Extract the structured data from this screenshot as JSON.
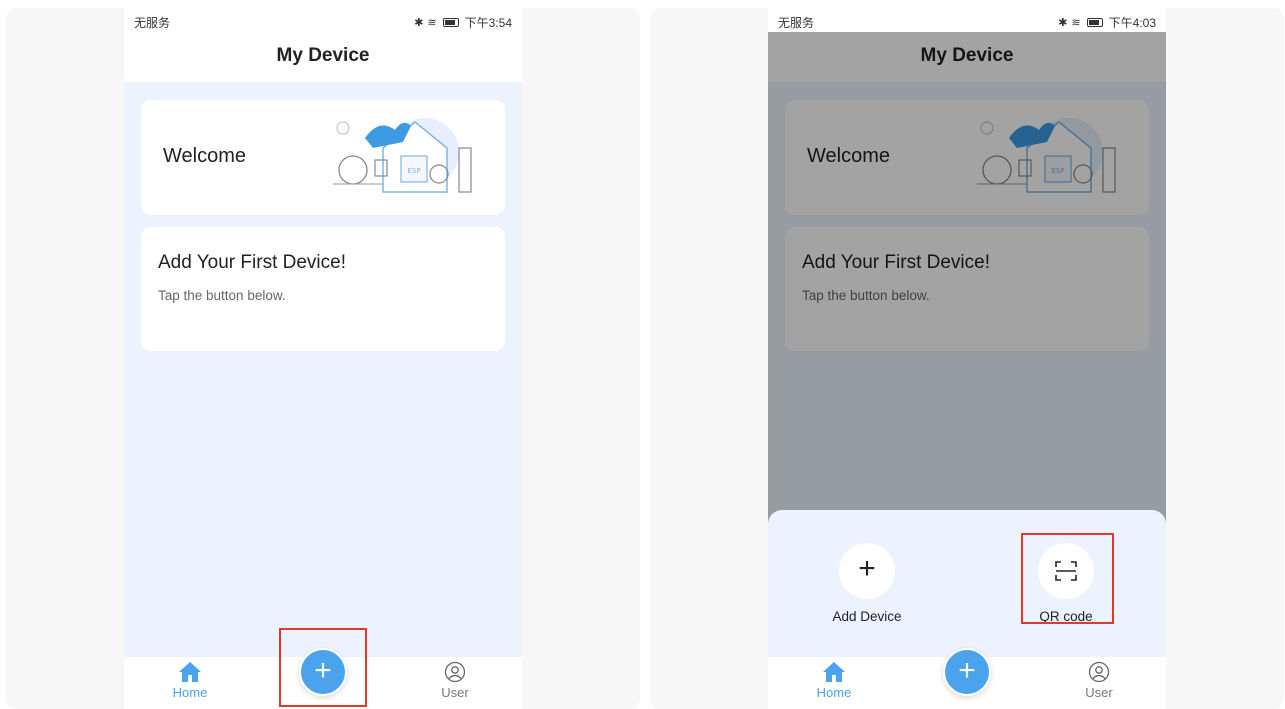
{
  "screens": [
    {
      "status": {
        "carrier": "无服务",
        "time": "下午3:54"
      },
      "header": {
        "title": "My Device"
      },
      "welcome": {
        "text": "Welcome",
        "illustration_label": "ESP"
      },
      "first_device": {
        "title": "Add Your First Device!",
        "subtitle": "Tap the button below."
      },
      "tabbar": {
        "home_label": "Home",
        "user_label": "User",
        "fab_symbol": "+"
      }
    },
    {
      "status": {
        "carrier": "无服务",
        "time": "下午4:03"
      },
      "header": {
        "title": "My Device"
      },
      "welcome": {
        "text": "Welcome",
        "illustration_label": "ESP"
      },
      "first_device": {
        "title": "Add Your First Device!",
        "subtitle": "Tap the button below."
      },
      "tabbar": {
        "home_label": "Home",
        "user_label": "User",
        "fab_symbol": "+"
      },
      "sheet": {
        "add_device_label": "Add Device",
        "qr_code_label": "QR code",
        "add_symbol": "+"
      }
    }
  ],
  "colors": {
    "accent": "#4aa3ec",
    "highlight_box": "#e3382d",
    "background": "#ecf2fe"
  },
  "icons": [
    "bluetooth-icon",
    "wifi-icon",
    "battery-icon",
    "home-icon",
    "user-icon",
    "plus-icon",
    "qr-scan-icon"
  ]
}
